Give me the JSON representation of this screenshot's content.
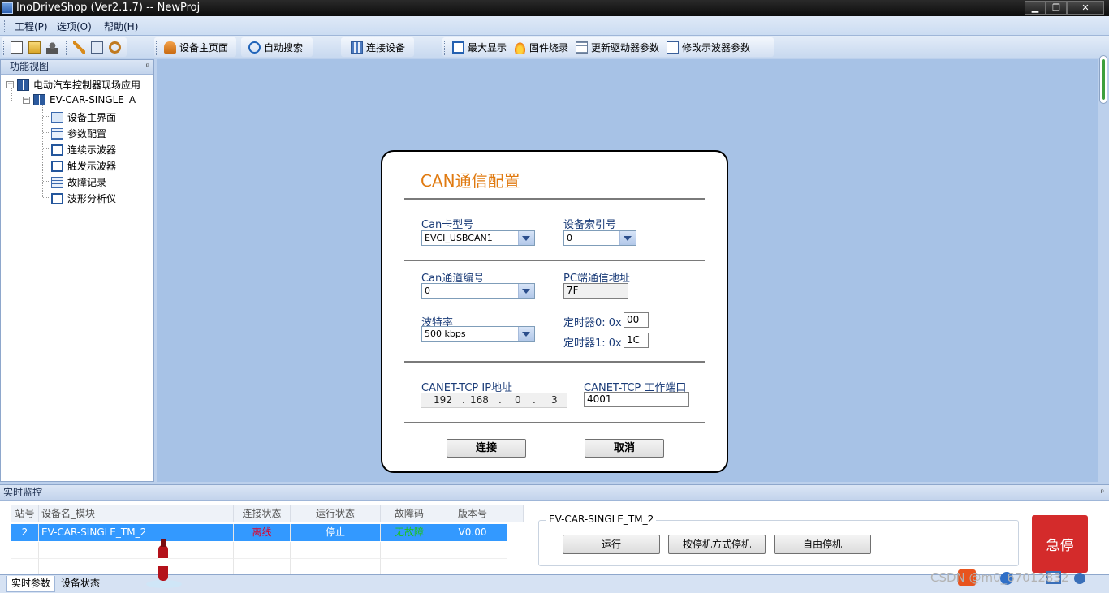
{
  "window": {
    "title": "InoDriveShop (Ver2.1.7) -- NewProj",
    "controls": {
      "minimize": "▁",
      "maximize": "❐",
      "close": "✕"
    }
  },
  "menu": [
    "工程(P)",
    "选项(O)",
    "帮助(H)"
  ],
  "toolbar": {
    "device_home": "设备主页面",
    "auto_search": "自动搜索",
    "connect_device": "连接设备",
    "maximize_display": "最大显示",
    "firmware_burn": "固件烧录",
    "update_driver_params": "更新驱动器参数",
    "modify_scope_params": "修改示波器参数"
  },
  "left_panel": {
    "title": "功能视图",
    "pin": "ᵖ",
    "root": "电动汽车控制器现场应用",
    "device": "EV-CAR-SINGLE_A",
    "items": [
      "设备主界面",
      "参数配置",
      "连续示波器",
      "触发示波器",
      "故障记录",
      "波形分析仪"
    ]
  },
  "dialog": {
    "title": "CAN通信配置",
    "can_card_type_label": "Can卡型号",
    "can_card_type_value": "EVCI_USBCAN1",
    "device_index_label": "设备索引号",
    "device_index_value": "0",
    "can_channel_label": "Can通道编号",
    "can_channel_value": "0",
    "pc_address_label": "PC端通信地址",
    "pc_address_value": "7F",
    "baud_rate_label": "波特率",
    "baud_rate_value": "500 kbps",
    "timer0_label": "定时器0: 0x",
    "timer0_value": "00",
    "timer1_label": "定时器1: 0x",
    "timer1_value": "1C",
    "canet_ip_label": "CANET-TCP IP地址",
    "canet_ip": [
      "192",
      "168",
      "0",
      "3"
    ],
    "ip_dot": ".",
    "canet_port_label": "CANET-TCP 工作端口",
    "canet_port_value": "4001",
    "connect_button": "连接",
    "cancel_button": "取消"
  },
  "monitor": {
    "title": "实时监控",
    "pin": "ᵖ",
    "headers": [
      "站号",
      "设备名_模块",
      "连接状态",
      "运行状态",
      "故障码",
      "版本号"
    ],
    "row": {
      "station": "2",
      "name": "EV-CAR-SINGLE_TM_2",
      "connection": "离线",
      "run_state": "停止",
      "fault": "无故障",
      "version": "V0.00"
    },
    "group_title": "EV-CAR-SINGLE_TM_2",
    "run_button": "运行",
    "stop_by_mode_button": "按停机方式停机",
    "free_stop_button": "自由停机",
    "estop_button": "急停"
  },
  "bottom_tabs": [
    "实时参数",
    "设备状态"
  ],
  "watermark": "CSDN @m0_67012832",
  "colors": {
    "accent_orange": "#e07a10",
    "selection_blue": "#3399ff",
    "offline_red": "#e0002a",
    "ok_green": "#1ec21e",
    "estop_red": "#d42b2b"
  }
}
